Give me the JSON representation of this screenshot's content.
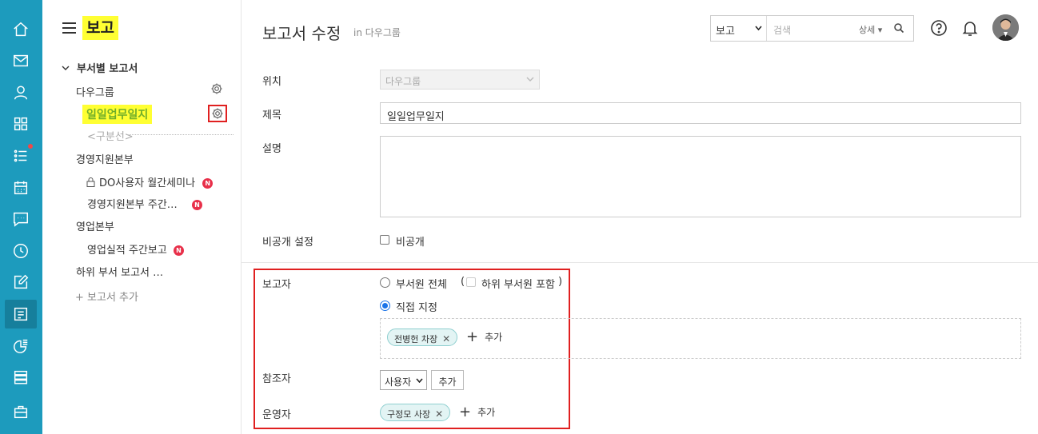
{
  "rail": {
    "items": [
      {
        "icon": "home-icon"
      },
      {
        "icon": "mail-icon"
      },
      {
        "icon": "user-icon"
      },
      {
        "icon": "apps-grid-icon"
      },
      {
        "icon": "task-list-icon",
        "has_dot": true
      },
      {
        "icon": "calendar-icon"
      },
      {
        "icon": "chat-icon"
      },
      {
        "icon": "clock-icon"
      },
      {
        "icon": "edit-icon"
      },
      {
        "icon": "report-icon",
        "active": true
      },
      {
        "icon": "survey-icon"
      },
      {
        "icon": "board-icon"
      },
      {
        "icon": "briefcase-icon"
      }
    ],
    "accent": "#1d9bbd",
    "active_bg": "#167f9c",
    "dot_color": "#f04848"
  },
  "side": {
    "app_title": "보고",
    "section_title": "부서별 보고서",
    "items": {
      "group1": "다우그룹",
      "selected": "일일업무일지",
      "divider": "<구분선>",
      "group2": "경영지원본부",
      "item_locked": "DO사용자 월간세미나",
      "item_weekly": "경영지원본부 주간…",
      "group3": "영업본부",
      "item_sales": "영업실적 주간보고",
      "sub_reports": "하위 부서 보고서 …",
      "add_report": "+ 보고서 추가"
    },
    "badge": "N",
    "highlight": "#ffff33",
    "selected_color": "#6fae2a"
  },
  "header": {
    "title": "보고서 수정",
    "subtitle": "in 다우그룹",
    "search_scope": "보고",
    "search_placeholder": "검색",
    "search_detail": "상세"
  },
  "form": {
    "location_label": "위치",
    "location_value": "다우그룹",
    "title_label": "제목",
    "title_value": "일일업무일지",
    "desc_label": "설명",
    "private_label": "비공개 설정",
    "private_checkbox": "비공개",
    "reporter_label": "보고자",
    "reporter_all": "부서원 전체",
    "reporter_sub_paren_open": "(",
    "reporter_sub": "하위 부서원 포함",
    "reporter_sub_paren_close": ")",
    "reporter_direct": "직접 지정",
    "reporter_tag": "전병헌 차장",
    "add_label": "추가",
    "ref_label": "참조자",
    "ref_select": "사용자",
    "ref_button": "추가",
    "admin_label": "운영자",
    "admin_tag": "구정모 사장"
  }
}
